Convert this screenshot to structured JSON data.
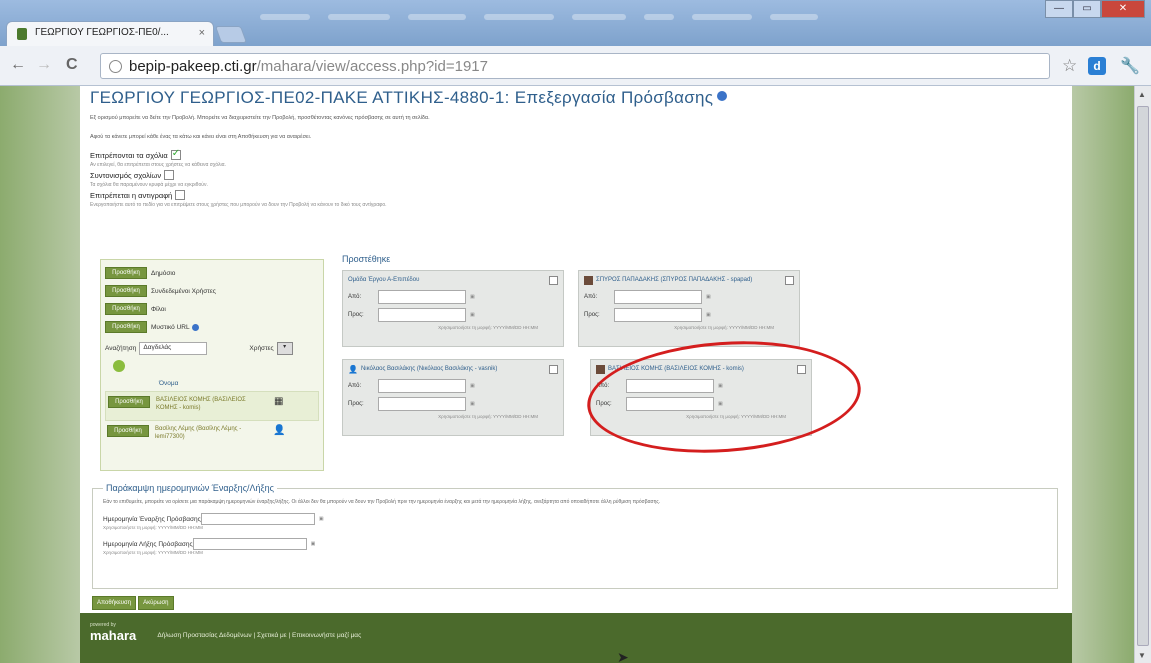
{
  "browser": {
    "tab_title": "ΓΕΩΡΓΙΟΥ ΓΕΩΡΓΙΟΣ-ΠΕ0/...",
    "tab_close": "×",
    "url_host": "bepip-pakeep.cti.gr",
    "url_path": "/mahara/view/access.php?id=1917",
    "back": "←",
    "forward": "→",
    "reload": "C",
    "star": "☆",
    "ext_label": "d",
    "wrench": "🔧",
    "win_min": "—",
    "win_max": "▭",
    "win_close": "✕"
  },
  "page": {
    "title": "ΓΕΩΡΓΙΟΥ ΓΕΩΡΓΙΟΣ-ΠΕ02-ΠΑΚΕ ΑΤΤΙΚΗΣ-4880-1: Επεξεργασία Πρόσβασης",
    "intro": "Εξ ορισμού μπορείτε να δείτε την Προβολή. Μπορείτε να διαχειριστείτε την Προβολή, προσθέτοντας κανόνες πρόσβασης σε αυτή τη σελίδα.",
    "intro2": "Αφού τα κάνετε μπορεί κάθε ένας τα κάτω και κάνει είναι στη Αποθήκευση για να αναιρέσει.",
    "options": [
      {
        "label": "Επιτρέπονται τα σχόλια",
        "checked": true,
        "desc": "Αν επιλεγεί, θα επιτρέπεται στους χρήστες να κάθεινα σχόλια."
      },
      {
        "label": "Συντονισμός σχολίων",
        "checked": false,
        "desc": "Τα σχόλια θα παραμένουν κρυφά μέχρι να εγκριθούν."
      },
      {
        "label": "Επιτρέπεται η αντιγραφή",
        "checked": false,
        "desc": "Ενεργοποιήστε αυτό το πεδίο για να επιτρέψετε στους χρήστες που μπορούν να δουν την Προβολή να κάνουν το δικό τους αντίγραφο."
      }
    ]
  },
  "available": {
    "share_button": "Προσθήκη",
    "rows": [
      {
        "label": "Δημόσιο",
        "help": false
      },
      {
        "label": "Συνδεδεμένοι Χρήστες",
        "help": false
      },
      {
        "label": "Φίλοι",
        "help": false
      },
      {
        "label": "Μυστικό URL",
        "help": true
      }
    ],
    "search_label": "Αναζήτηση",
    "search_value": "Δαγδελάς",
    "search_type": "Χρήστες",
    "search_go": "▾",
    "results_header": "Όνομα",
    "results": [
      {
        "name": "ΒΑΣΙΛΕΙΟΣ ΚΟΜΗΣ (ΒΑΣΙΛΕΙΟΣ ΚΟΜΗΣ - komis)",
        "icon": "▦"
      },
      {
        "name": "Βασίλης Λέμης (Βασίλης Λέμης - lemi77300)",
        "icon": "👤"
      }
    ]
  },
  "added": {
    "title": "Προστέθηκε",
    "from_label": "Από:",
    "to_label": "Προς:",
    "cal": "▣",
    "hint": "Χρησιμοποιήστε τη μορφή: YYYY/MM/DD HH:MM",
    "cards": [
      {
        "name": "Ομάδα Έργου Α-Επιπέδου",
        "icon": "none"
      },
      {
        "name": "ΣΠΥΡΟΣ ΠΑΠΑΔΑΚΗΣ (ΣΠΥΡΟΣ ΠΑΠΑΔΑΚΗΣ - spapad)",
        "icon": "image"
      },
      {
        "name": "Νικόλαος Βασιλάκης (Νικόλαος Βασιλάκης - vasnik)",
        "icon": "person"
      },
      {
        "name": "ΒΑΣΙΛΕΙΟΣ ΚΟΜΗΣ (ΒΑΣΙΛΕΙΟΣ ΚΟΜΗΣ - komis)",
        "icon": "image"
      }
    ]
  },
  "period": {
    "legend": "Παράκαμψη ημερομηνιών Έναρξης/Λήξης",
    "desc": "Εάν το επιθυμείτε, μπορείτε να ορίσετε μια παράκαμψη ημερομηνιών έναρξης/λήξης. Οι άλλοι δεν θα μπορούν να δουν την Προβολή πριν την ημερομηνία έναρξης και μετά την ημερομηνία λήξης, ανεξάρτητα από οποιαδήποτε άλλη ρύθμιση πρόσβασης.",
    "start_label": "Ημερομηνία Έναρξης Πρόσβασης",
    "end_label": "Ημερομηνία Λήξης Πρόσβασης",
    "hint": "Χρησιμοποιήστε τη μορφή: YYYY/MM/DD HH:MM"
  },
  "buttons": {
    "save": "Αποθήκευση",
    "cancel": "Ακύρωση"
  },
  "footer": {
    "powered_by": "powered by",
    "logo": "mahara",
    "links": "Δήλωση Προστασίας Δεδομένων  |  Σχετικά με  |  Επικοινωνήστε μαζί μας"
  }
}
